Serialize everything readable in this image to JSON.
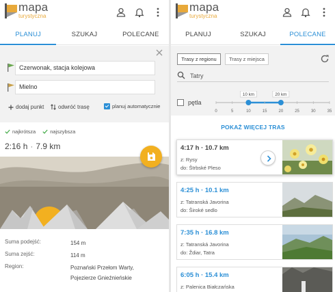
{
  "app": {
    "name": "mapa",
    "tagline": "turystyczna",
    "brand_color": "#e8a93a",
    "accent_color": "#2b8fd6"
  },
  "left": {
    "tabs": [
      {
        "label": "PLANUJ",
        "active": true
      },
      {
        "label": "SZUKAJ",
        "active": false
      },
      {
        "label": "POLECANE TRASY",
        "active": false
      }
    ],
    "planner": {
      "start": "Czerwonak, stacja kolejowa",
      "end": "Mielno",
      "add_point": "dodaj punkt",
      "reverse": "odwróć trasę",
      "auto_plan": "planuj automatycznie",
      "auto_plan_checked": true
    },
    "badges": [
      "najkrótsza",
      "najszybsza"
    ],
    "route": {
      "time": "2:16 h",
      "distance": "7.9 km"
    },
    "stats": [
      {
        "label": "Suma podejść:",
        "value": "154 m"
      },
      {
        "label": "Suma zejść:",
        "value": "114 m"
      },
      {
        "label": "Region:",
        "value_line1": "Poznański Przełom Warty,",
        "value_line2": "Pojezierze Gnieźnieńskie"
      }
    ]
  },
  "right": {
    "tabs": [
      {
        "label": "PLANUJ",
        "active": false
      },
      {
        "label": "SZUKAJ",
        "active": false
      },
      {
        "label": "POLECANE TRASY",
        "active": true
      }
    ],
    "filter": {
      "segments": [
        "Trasy z regionu",
        "Trasy z miejsca"
      ],
      "active_segment": 0,
      "search": "Tatry",
      "loop_label": "pętla",
      "loop_checked": false,
      "slider_ticks": [
        "0",
        "5",
        "10",
        "15",
        "20",
        "25",
        "30",
        "35"
      ],
      "slider_min_label": "10 km",
      "slider_max_label": "20 km",
      "slider_min": 10,
      "slider_max": 20
    },
    "more_label": "POKAŻ WIĘCEJ TRAS",
    "routes": [
      {
        "title": "4:17 h · 10.7 km",
        "from": "z: Rysy",
        "to": "do: Štrbské Pleso",
        "highlighted": true
      },
      {
        "title": "4:25 h · 10.1 km",
        "from": "z: Tatranská Javorina",
        "to": "do: Široké sedlo",
        "highlighted": false
      },
      {
        "title": "7:35 h · 16.8 km",
        "from": "z: Tatranská Javorina",
        "to": "do: Ždiar, Tatra",
        "highlighted": false
      },
      {
        "title": "6:05 h · 15.4 km",
        "from": "z: Palenica Białczańska",
        "to": "",
        "highlighted": false
      }
    ]
  }
}
